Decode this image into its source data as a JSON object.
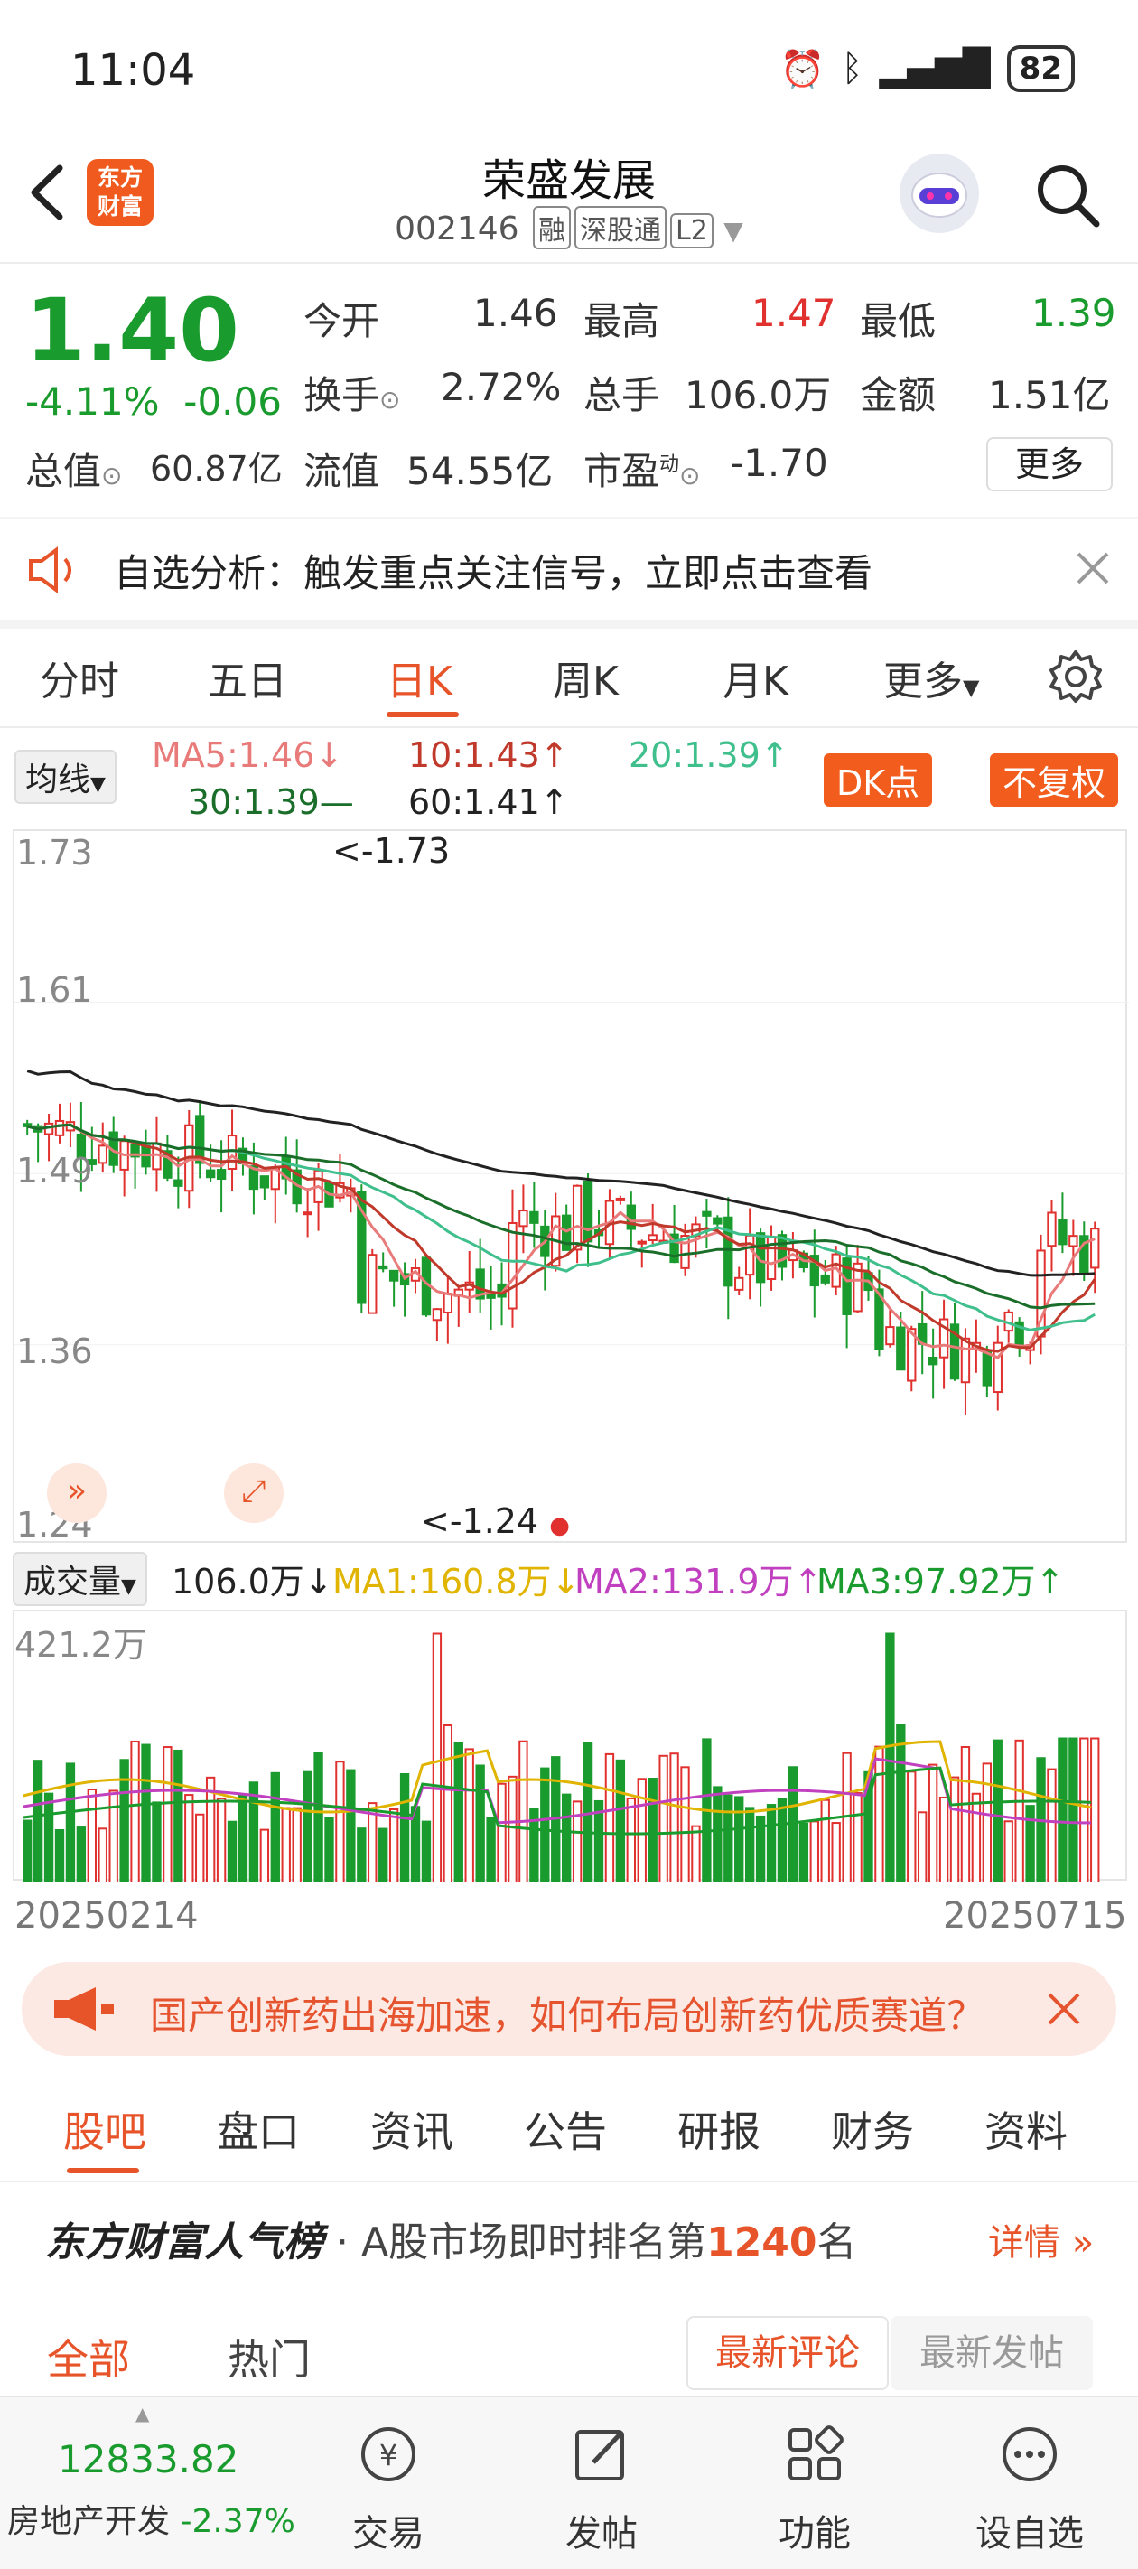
{
  "status": {
    "time": "11:04",
    "battery": "82"
  },
  "header": {
    "title": "荣盛发展",
    "code": "002146",
    "tags": [
      "融",
      "深股通",
      "L2"
    ]
  },
  "quote": {
    "price": "1.40",
    "change_pct": "-4.11%",
    "change": "-0.06",
    "open_label": "今开",
    "open": "1.46",
    "high_label": "最高",
    "high": "1.47",
    "low_label": "最低",
    "low": "1.39",
    "turnover_label": "换手",
    "turnover": "2.72%",
    "volume_label": "总手",
    "volume": "106.0万",
    "amount_label": "金额",
    "amount": "1.51亿",
    "mktcap_label": "总值",
    "mktcap": "60.87亿",
    "float_label": "流值",
    "float": "54.55亿",
    "pe_label": "市盈",
    "pe_sup": "动",
    "pe": "-1.70",
    "more": "更多"
  },
  "notice": {
    "text": "自选分析：触发重点关注信号，立即点击查看"
  },
  "ktabs": [
    "分时",
    "五日",
    "日K",
    "周K",
    "月K",
    "更多"
  ],
  "ma_bar": {
    "selector": "均线",
    "ma5": "MA5:1.46↓",
    "ma10": "10:1.43↑",
    "ma20": "20:1.39↑",
    "ma30": "30:1.39—",
    "ma60": "60:1.41↑",
    "dk_btn": "DK点",
    "fq_btn": "不复权"
  },
  "chart_axes": {
    "y_ticks": [
      "1.73",
      "1.61",
      "1.49",
      "1.36",
      "1.24"
    ],
    "high_note": "<-1.73",
    "low_note": "<-1.24"
  },
  "volume_bar": {
    "selector": "成交量",
    "current": "106.0万↓",
    "ma1": "MA1:160.8万↓",
    "ma2": "MA2:131.9万↑",
    "ma3": "MA3:97.92万↑",
    "max_label": "421.2万",
    "start_date": "20250214",
    "end_date": "20250715"
  },
  "banner": {
    "text": "国产创新药出海加速，如何布局创新药优质赛道？"
  },
  "btabs": [
    "股吧",
    "盘口",
    "资讯",
    "公告",
    "研报",
    "财务",
    "资料"
  ],
  "rank": {
    "brand": "东方财富人气榜",
    "prefix": "· A股市场即时排名第",
    "number": "1240",
    "suffix": "名",
    "detail": "详情"
  },
  "feed_tabs": [
    "全部",
    "热门"
  ],
  "sort_tabs": [
    "最新评论",
    "最新发帖"
  ],
  "bottom_nav": {
    "index_value": "12833.82",
    "index_name": "房地产开发",
    "index_change": "-2.37%",
    "items": [
      "交易",
      "发帖",
      "功能",
      "设自选"
    ]
  },
  "colors": {
    "accent": "#e8542a",
    "up": "#e0312f",
    "down": "#1a9b2e"
  },
  "chart_data": {
    "type": "candlestick",
    "x_start": "20250214",
    "x_end": "20250715",
    "ylim": [
      1.24,
      1.73
    ],
    "ma_lines": [
      "MA5",
      "MA10",
      "MA20",
      "MA30",
      "MA60"
    ]
  }
}
